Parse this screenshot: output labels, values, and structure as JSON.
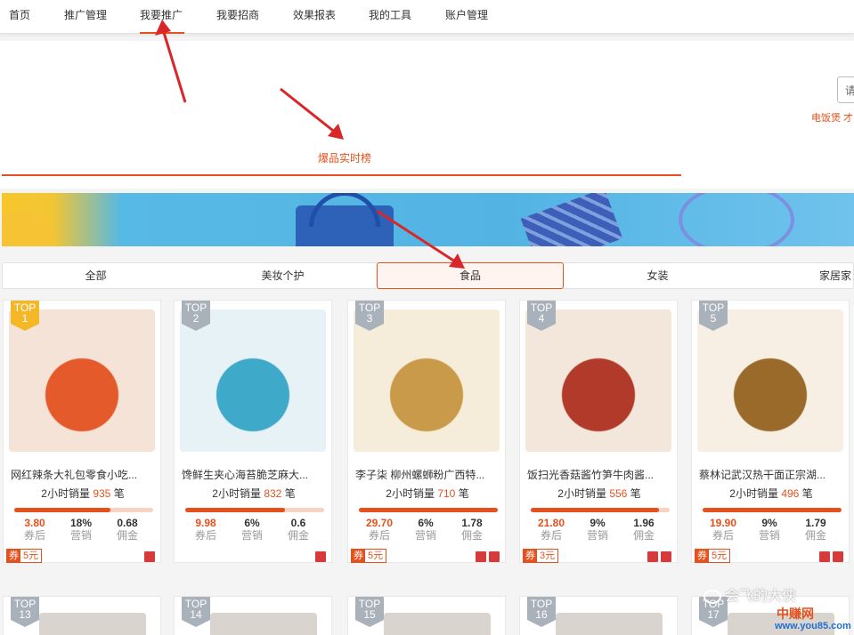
{
  "nav": {
    "items": [
      "首页",
      "推广管理",
      "我要推广",
      "我要招商",
      "效果报表",
      "我的工具",
      "账户管理"
    ],
    "active_index": 2
  },
  "header": {
    "search_fragment": "请",
    "hotword": "电饭煲  才",
    "section_title": "爆品实时榜"
  },
  "tabs": {
    "items": [
      "全部",
      "美妆个护",
      "食品",
      "女装",
      "家居家"
    ],
    "active_index": 2
  },
  "colors": {
    "accent": "#e5511d",
    "badge_gold": "#f4b728",
    "badge_gray": "#a9b1ba"
  },
  "products": [
    {
      "rank_top": "TOP",
      "rank": "1",
      "title": "网红辣条大礼包零食小吃...",
      "sales_prefix": "2小时销量",
      "sales": "935",
      "sales_suffix": "笔",
      "price": "3.80",
      "price_label": "券后",
      "marketing": "18%",
      "marketing_label": "营销",
      "commission": "0.68",
      "commission_label": "佣金",
      "coupon_q": "券",
      "coupon_amount": "5元",
      "progress": 0.69
    },
    {
      "rank_top": "TOP",
      "rank": "2",
      "title": "馋鲜生夹心海苔脆芝麻大...",
      "sales_prefix": "2小时销量",
      "sales": "832",
      "sales_suffix": "笔",
      "price": "9.98",
      "price_label": "券后",
      "marketing": "6%",
      "marketing_label": "营销",
      "commission": "0.6",
      "commission_label": "佣金",
      "coupon_q": "",
      "coupon_amount": "",
      "progress": 0.72
    },
    {
      "rank_top": "TOP",
      "rank": "3",
      "title": "李子柒 柳州螺蛳粉广西特...",
      "sales_prefix": "2小时销量",
      "sales": "710",
      "sales_suffix": "笔",
      "price": "29.70",
      "price_label": "券后",
      "marketing": "6%",
      "marketing_label": "营销",
      "commission": "1.78",
      "commission_label": "佣金",
      "coupon_q": "券",
      "coupon_amount": "5元",
      "progress": 1.0
    },
    {
      "rank_top": "TOP",
      "rank": "4",
      "title": "饭扫光香菇酱竹笋牛肉酱...",
      "sales_prefix": "2小时销量",
      "sales": "556",
      "sales_suffix": "笔",
      "price": "21.80",
      "price_label": "券后",
      "marketing": "9%",
      "marketing_label": "营销",
      "commission": "1.96",
      "commission_label": "佣金",
      "coupon_q": "券",
      "coupon_amount": "3元",
      "progress": 0.92
    },
    {
      "rank_top": "TOP",
      "rank": "5",
      "title": "蔡林记武汉热干面正宗湖...",
      "sales_prefix": "2小时销量",
      "sales": "496",
      "sales_suffix": "笔",
      "price": "19.90",
      "price_label": "券后",
      "marketing": "9%",
      "marketing_label": "营销",
      "commission": "1.79",
      "commission_label": "佣金",
      "coupon_q": "券",
      "coupon_amount": "5元",
      "progress": 1.0
    }
  ],
  "row2_badges": [
    {
      "rank_top": "TOP",
      "rank": "13"
    },
    {
      "rank_top": "TOP",
      "rank": "14"
    },
    {
      "rank_top": "TOP",
      "rank": "15"
    },
    {
      "rank_top": "TOP",
      "rank": "16"
    },
    {
      "rank_top": "TOP",
      "rank": "17"
    }
  ],
  "watermark": {
    "text": "会飞的大侠",
    "site_cn": "中赚网",
    "site_url": "www.you85.com"
  }
}
